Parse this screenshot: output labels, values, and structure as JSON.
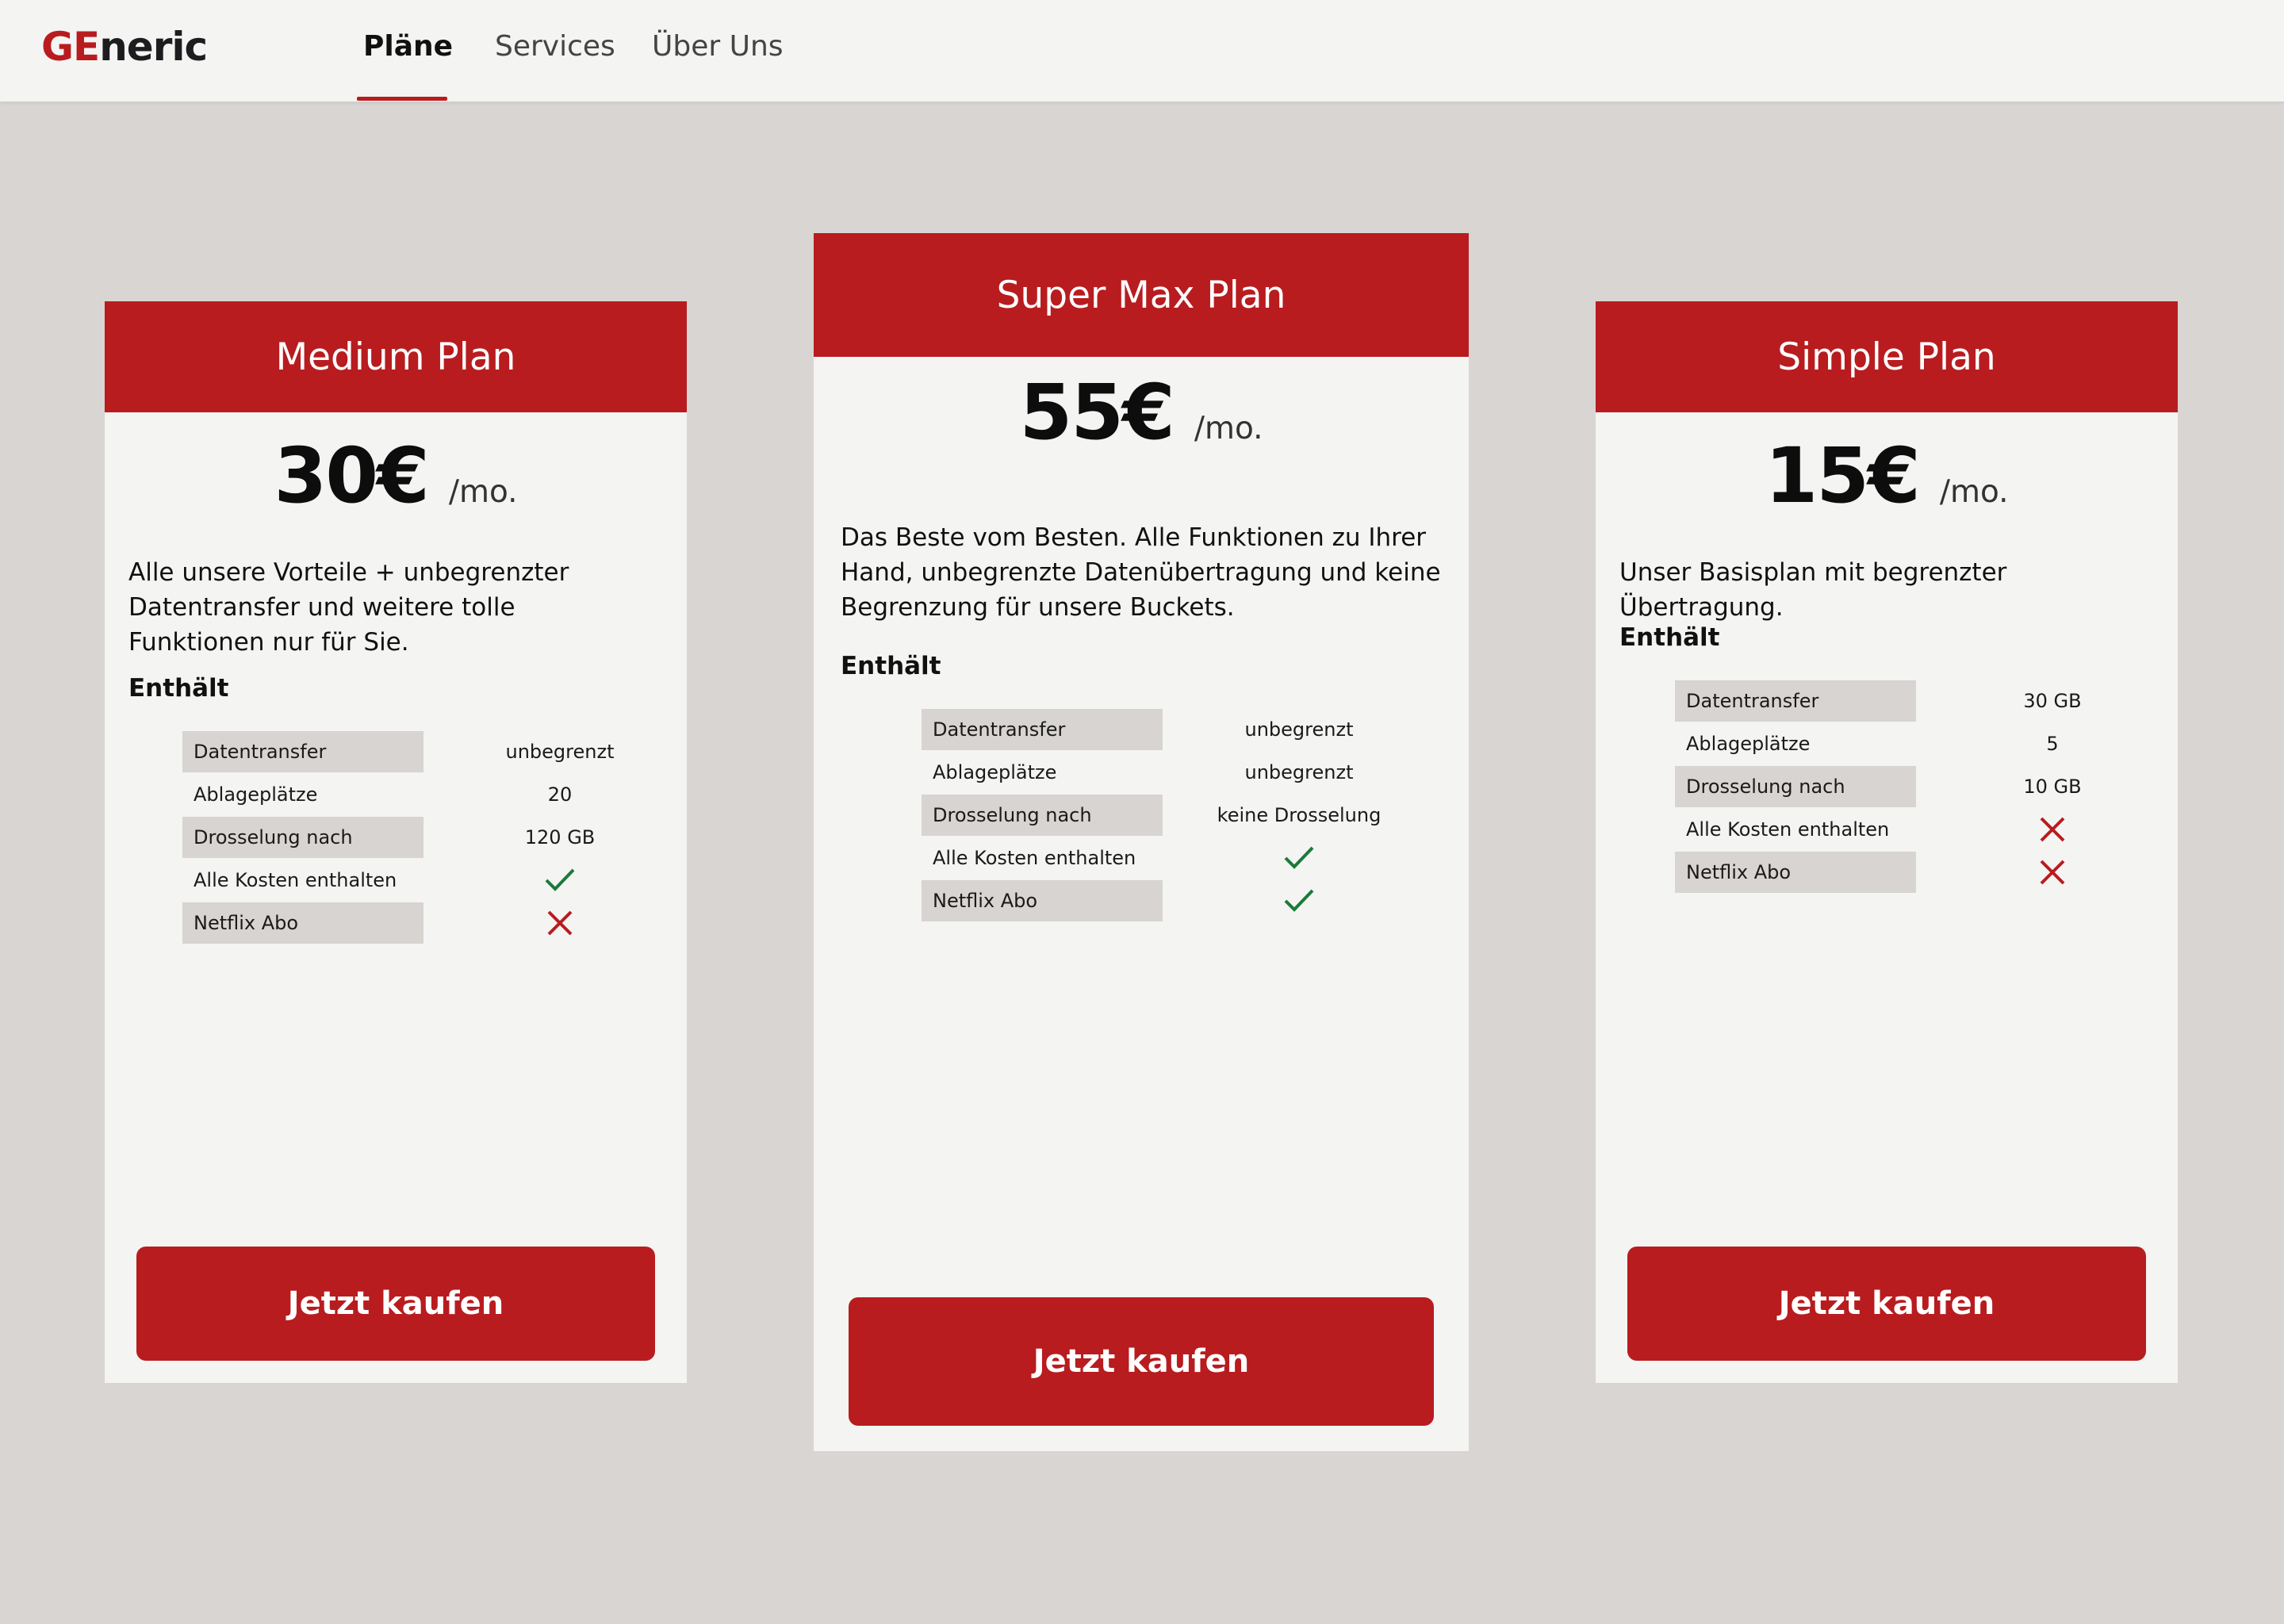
{
  "brand": {
    "logo_accent": "GE",
    "logo_rest": "neric",
    "accent_color": "#b81c1f"
  },
  "nav": {
    "items": [
      "Pläne",
      "Services",
      "Über Uns"
    ],
    "active": "Pläne"
  },
  "plans": [
    {
      "name": "Medium Plan",
      "price": "30€",
      "period": "/mo.",
      "description": "Alle unsere Vorteile + unbegrenzter Datentransfer und weitere tolle Funktionen nur für Sie.",
      "contains_label": "Enthält",
      "features": [
        {
          "name": "Datentransfer",
          "value": "unbegrenzt"
        },
        {
          "name": "Ablageplätze",
          "value": "20"
        },
        {
          "name": "Drosselung nach",
          "value": "120 GB"
        },
        {
          "name": "Alle Kosten enthalten",
          "icon": "check-icon"
        },
        {
          "name": "Netflix Abo",
          "icon": "cross-icon"
        }
      ],
      "cta": "Jetzt kaufen"
    },
    {
      "name": "Super Max Plan",
      "price": "55€",
      "period": "/mo.",
      "description": "Das Beste vom Besten. Alle Funktionen zu Ihrer Hand, unbegrenzte Datenübertragung und keine Begrenzung für unsere Buckets.",
      "contains_label": "Enthält",
      "features": [
        {
          "name": "Datentransfer",
          "value": "unbegrenzt"
        },
        {
          "name": "Ablageplätze",
          "value": "unbegrenzt"
        },
        {
          "name": "Drosselung nach",
          "value": "keine Drosselung"
        },
        {
          "name": "Alle Kosten enthalten",
          "icon": "check-icon"
        },
        {
          "name": "Netflix Abo",
          "icon": "check-icon"
        }
      ],
      "cta": "Jetzt kaufen"
    },
    {
      "name": "Simple Plan",
      "price": "15€",
      "period": "/mo.",
      "description": "Unser Basisplan mit begrenzter Übertragung.",
      "contains_label": "Enthält",
      "features": [
        {
          "name": "Datentransfer",
          "value": "30 GB"
        },
        {
          "name": "Ablageplätze",
          "value": "5"
        },
        {
          "name": "Drosselung nach",
          "value": "10 GB"
        },
        {
          "name": "Alle Kosten enthalten",
          "icon": "cross-icon"
        },
        {
          "name": "Netflix Abo",
          "icon": "cross-icon"
        }
      ],
      "cta": "Jetzt kaufen"
    }
  ]
}
